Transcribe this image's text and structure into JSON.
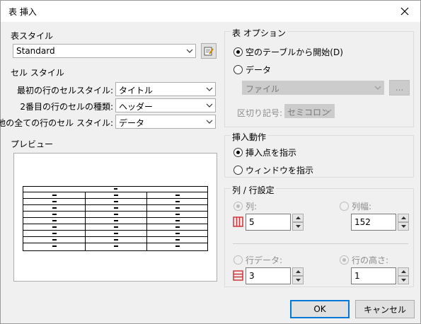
{
  "window": {
    "title": "表 挿入"
  },
  "table_style": {
    "heading": "表スタイル",
    "selected": "Standard"
  },
  "cell_style": {
    "heading": "セル スタイル",
    "rows": [
      {
        "label": "最初の行のセルスタイル:",
        "value": "タイトル"
      },
      {
        "label": "2番目の行のセルの種類:",
        "value": "ヘッダー"
      },
      {
        "label": "他の全ての行のセル スタイル:",
        "value": "データ"
      }
    ]
  },
  "preview": {
    "heading": "プレビュー"
  },
  "table_options": {
    "heading": "表 オプション",
    "radio_empty": "空のテーブルから開始(D)",
    "radio_data": "データ",
    "file_value": "ファイル",
    "browse_label": "...",
    "delimiter_label": "区切り記号:",
    "delimiter_value": "セミコロン"
  },
  "insert_behavior": {
    "heading": "挿入動作",
    "radio_point": "挿入点を指示",
    "radio_window": "ウィンドウを指示"
  },
  "rows_columns": {
    "heading": "列 / 行設定",
    "columns_label": "列:",
    "columns_value": "5",
    "column_width_label": "列幅:",
    "column_width_value": "152",
    "data_rows_label": "行データ:",
    "data_rows_value": "3",
    "row_height_label": "行の高さ:",
    "row_height_value": "1"
  },
  "buttons": {
    "ok": "OK",
    "cancel": "キャンセル"
  },
  "colors": {
    "accent": "#0078d7",
    "icon_red": "#d13438"
  }
}
